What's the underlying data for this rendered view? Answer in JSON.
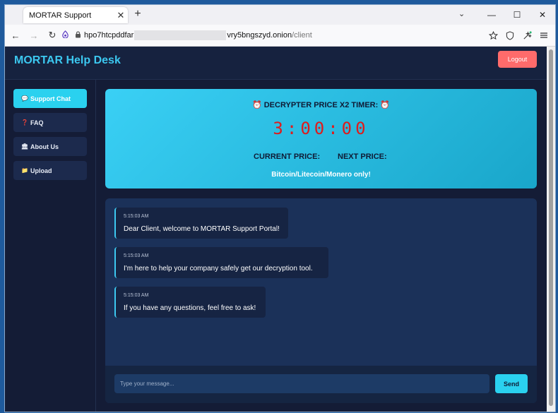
{
  "browser": {
    "tab_title": "MORTAR Support",
    "tab_close": "✕",
    "new_tab": "+",
    "tab_list": "⌄",
    "window_controls": {
      "minimize": "—",
      "maximize": "☐",
      "close": "✕"
    },
    "nav": {
      "back": "←",
      "forward": "→",
      "reload": "↻"
    },
    "url": {
      "site_icon": "onion-icon",
      "host_start": "hpo7htcpddfar",
      "host_end": "vry5bngszyd.onion",
      "path": "/client"
    },
    "toolbar_icons": [
      "bookmark-star-icon",
      "shield-icon",
      "extensions-icon",
      "menu-icon"
    ]
  },
  "header": {
    "brand": "MORTAR Help Desk",
    "logout_label": "Logout"
  },
  "sidebar": {
    "items": [
      {
        "icon": "💬",
        "label": "Support Chat",
        "active": true
      },
      {
        "icon": "❓",
        "label": "FAQ"
      },
      {
        "icon": "🏛",
        "label": "About Us"
      },
      {
        "icon": "📁",
        "label": "Upload"
      }
    ]
  },
  "timer": {
    "title": "⏰ DECRYPTER PRICE X2 TIMER: ⏰",
    "clock": "3:00:00",
    "current_price_label": "CURRENT PRICE:",
    "next_price_label": "NEXT PRICE:",
    "note": "Bitcoin/Litecoin/Monero only!"
  },
  "chat": {
    "messages": [
      {
        "time": "5:15:03 AM",
        "text": "Dear Client, welcome to MORTAR Support Portal!"
      },
      {
        "time": "5:15:03 AM",
        "text": "I'm here to help your company safely get our decryption tool."
      },
      {
        "time": "5:15:03 AM",
        "text": "If you have any questions, feel free to ask!"
      }
    ],
    "input_placeholder": "Type your message...",
    "send_label": "Send"
  },
  "colors": {
    "accent": "#2ad1ef",
    "brand_text": "#3cc8f0",
    "logout": "#ff6b6b",
    "timer_digits": "#e01b1b",
    "page_bg": "#141c36",
    "chat_bg": "#1b3159"
  }
}
